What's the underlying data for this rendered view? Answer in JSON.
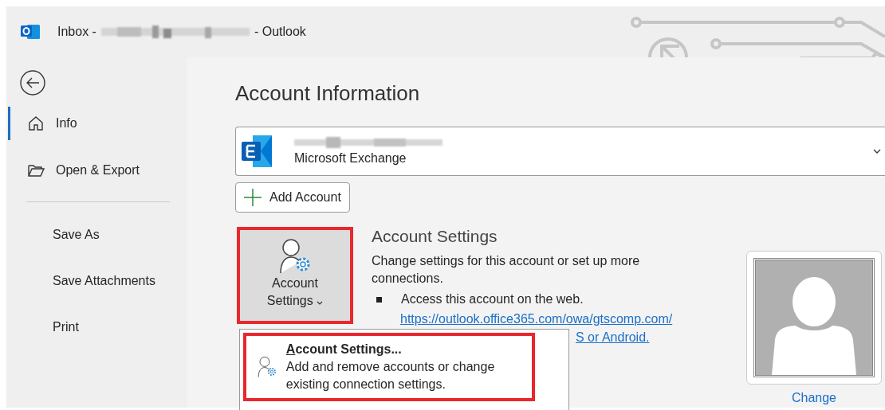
{
  "window": {
    "title_prefix": "Inbox -",
    "title_suffix": "- Outlook"
  },
  "sidebar": {
    "nav": [
      {
        "label": "Info",
        "selected": true
      },
      {
        "label": "Open & Export",
        "selected": false
      }
    ],
    "commands": [
      "Save As",
      "Save Attachments",
      "Print"
    ]
  },
  "main": {
    "heading": "Account Information",
    "account": {
      "type": "Microsoft Exchange"
    },
    "add_button": "Add Account",
    "settings_button": {
      "line1": "Account",
      "line2": "Settings"
    },
    "section_title": "Account Settings",
    "description": "Change settings for this account or set up more connections.",
    "bullet": "Access this account on the web.",
    "link": "https://outlook.office365.com/owa/gtscomp.com/",
    "link_2": "S or Android.",
    "menu": [
      {
        "title": "Account Settings...",
        "description": "Add and remove accounts or change existing connection settings."
      }
    ],
    "photo_link": "Change"
  }
}
